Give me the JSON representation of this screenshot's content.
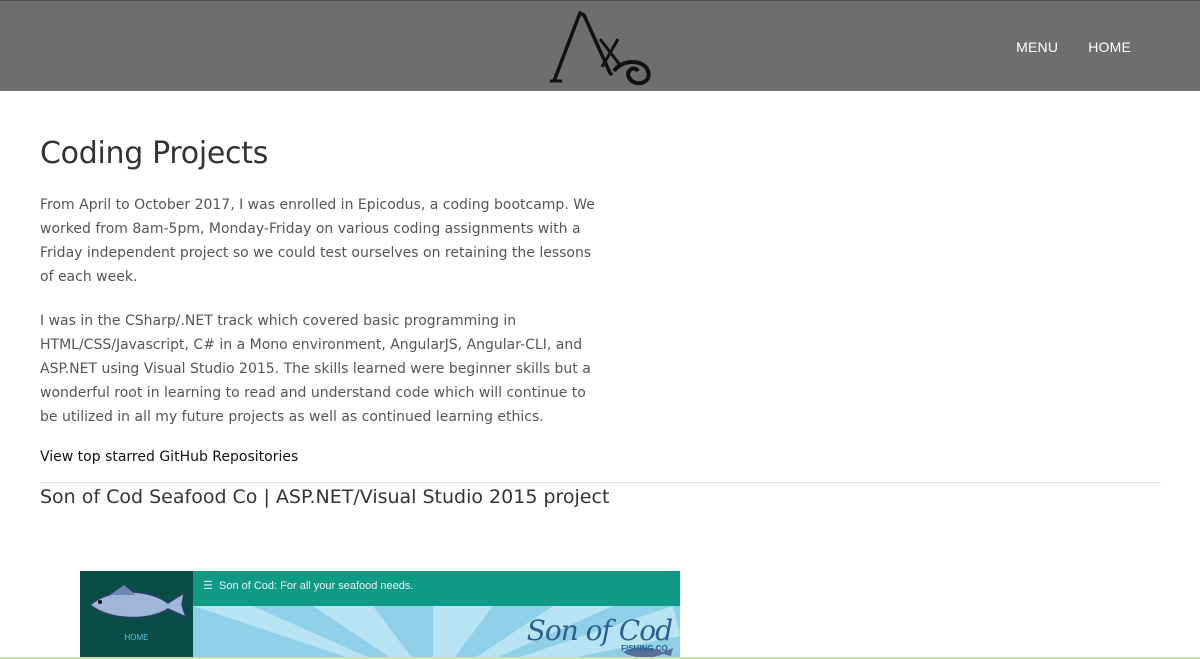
{
  "header": {
    "nav": [
      "MENU",
      "HOME"
    ]
  },
  "main": {
    "title": "Coding Projects",
    "paragraphs": [
      "From April to October 2017, I was enrolled in Epicodus, a coding bootcamp. We worked from 8am-5pm, Monday-Friday on various coding assignments with a Friday independent project so we could test ourselves on retaining the lessons of each week.",
      "I was in the CSharp/.NET track which covered basic programming in HTML/CSS/Javascript, C# in a Mono environment, AngularJS, Angular-CLI, and ASP.NET using Visual Studio 2015. The skills learned were beginner skills but a wonderful root in learning to read and understand code which will continue to be utilized in all my future projects as well as continued learning ethics."
    ],
    "github_link": "View top starred GitHub Repositories",
    "project_title": "Son of Cod Seafood Co | ASP.NET/Visual Studio 2015 project"
  },
  "thumbnail": {
    "menu_icon": "☰",
    "tagline": "Son of Cod: For all your seafood needs.",
    "home_label": "HOME",
    "brand": "Son of Cod",
    "brand_sub": "FISHING CO."
  },
  "colors": {
    "header_bg": "#6e6e6e",
    "thumb_side": "#0a4c47",
    "thumb_topbar": "#0e9a86",
    "thumb_hero": "#8fd0e8"
  }
}
